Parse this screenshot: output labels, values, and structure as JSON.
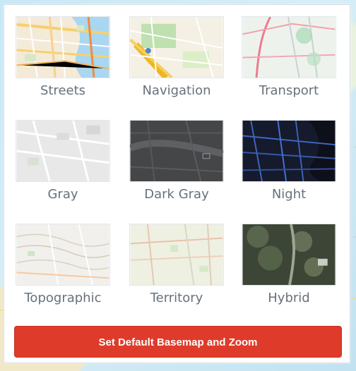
{
  "basemaps": [
    {
      "label": "Streets",
      "icon": "streets-thumbnail-icon"
    },
    {
      "label": "Navigation",
      "icon": "navigation-thumbnail-icon"
    },
    {
      "label": "Transport",
      "icon": "transport-thumbnail-icon"
    },
    {
      "label": "Gray",
      "icon": "gray-thumbnail-icon"
    },
    {
      "label": "Dark Gray",
      "icon": "dark-gray-thumbnail-icon"
    },
    {
      "label": "Night",
      "icon": "night-thumbnail-icon"
    },
    {
      "label": "Topographic",
      "icon": "topographic-thumbnail-icon"
    },
    {
      "label": "Territory",
      "icon": "territory-thumbnail-icon"
    },
    {
      "label": "Hybrid",
      "icon": "hybrid-thumbnail-icon"
    }
  ],
  "actions": {
    "set_default_label": "Set Default Basemap and Zoom"
  },
  "colors": {
    "button": "#df3b2a",
    "label_text": "#67717b",
    "panel": "#ffffff"
  }
}
